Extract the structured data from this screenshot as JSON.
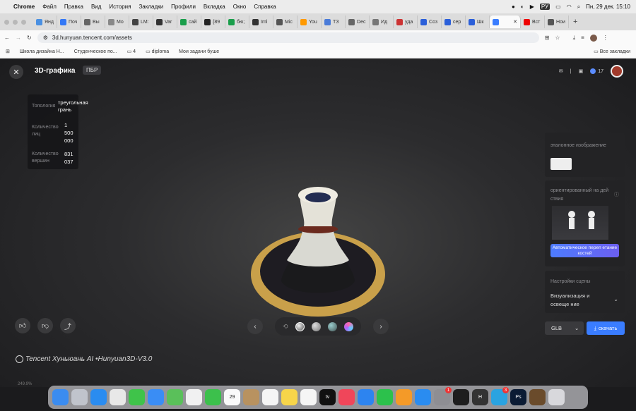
{
  "menubar": {
    "app": "Chrome",
    "items": [
      "Файл",
      "Правка",
      "Вид",
      "История",
      "Закладки",
      "Профили",
      "Вкладка",
      "Окно",
      "Справка"
    ],
    "lang": "РУ",
    "datetime": "Пн, 29 дек.  15:10"
  },
  "tabs": [
    {
      "label": "Янд",
      "color": "#4a90e2"
    },
    {
      "label": "Поч",
      "color": "#3478f6"
    },
    {
      "label": "Вы",
      "color": "#666"
    },
    {
      "label": "Мо",
      "color": "#888"
    },
    {
      "label": "LM:",
      "color": "#444"
    },
    {
      "label": "Var",
      "color": "#333"
    },
    {
      "label": "сай",
      "color": "#1a9e4b"
    },
    {
      "label": "{89",
      "color": "#222"
    },
    {
      "label": "бю;",
      "color": "#1a9e4b"
    },
    {
      "label": "Iml",
      "color": "#333"
    },
    {
      "label": "Mic",
      "color": "#555"
    },
    {
      "label": "You",
      "color": "#f90"
    },
    {
      "label": "ТЗ",
      "color": "#4a7bd8"
    },
    {
      "label": "Dec",
      "color": "#666"
    },
    {
      "label": "Ид",
      "color": "#777"
    },
    {
      "label": "уда",
      "color": "#c33"
    },
    {
      "label": "Соз",
      "color": "#2b5fd9"
    },
    {
      "label": "сер",
      "color": "#2b5fd9"
    },
    {
      "label": "Шк",
      "color": "#2b5fd9"
    },
    {
      "label": "",
      "color": "#3a7dff",
      "active": true
    },
    {
      "label": "Вст",
      "color": "#e00"
    },
    {
      "label": "Нои",
      "color": "#555"
    }
  ],
  "address": {
    "url": "3d.hunyuan.tencent.com/assets"
  },
  "bookmarks": {
    "items": [
      "Школа дизайна Н...",
      "Студенческое по...",
      "4",
      "diploma",
      "Мои задачи буше"
    ],
    "all": "Все закладки"
  },
  "app": {
    "title": "3D-графика",
    "badge": "ПБР",
    "credits": "17"
  },
  "stats": {
    "topology_label": "Топология",
    "topology_value": "треугольная грань",
    "faces_label": "Количество лиц",
    "faces_value": "1 500 000",
    "vertices_label": "Количество вершин",
    "vertices_value": "831 037"
  },
  "right_panel": {
    "reference_label": "эталонное изображение",
    "action_label": "ориентированный на дей ствия",
    "autorig_label": "Автоматическое переп етание костей",
    "scene_label": "Настройки сцены",
    "viz_label": "Визуализация и освеще ние",
    "format": "GLB",
    "download": "скачать"
  },
  "brand": "Tencent Хуньюань AI •Hunyuan3D-V3.0",
  "below_text": "249.9%",
  "dock": [
    {
      "name": "finder",
      "color": "#3b8cf0"
    },
    {
      "name": "launchpad",
      "color": "#c0c4cc"
    },
    {
      "name": "safari",
      "color": "#2a8cf0"
    },
    {
      "name": "chrome",
      "color": "#e8e8e8"
    },
    {
      "name": "messages",
      "color": "#3fc34a"
    },
    {
      "name": "mail",
      "color": "#3a8df5"
    },
    {
      "name": "maps",
      "color": "#5ac05a"
    },
    {
      "name": "photos",
      "color": "#f1f1f1"
    },
    {
      "name": "facetime",
      "color": "#3cc04c"
    },
    {
      "name": "calendar",
      "color": "#fafafa",
      "label": "29"
    },
    {
      "name": "contacts",
      "color": "#b89260"
    },
    {
      "name": "reminders",
      "color": "#f5f5f5"
    },
    {
      "name": "notes",
      "color": "#f7d54a"
    },
    {
      "name": "freeform",
      "color": "#f5f5f5"
    },
    {
      "name": "tv",
      "color": "#111",
      "label": "tv"
    },
    {
      "name": "music",
      "color": "#f0465a"
    },
    {
      "name": "keynote",
      "color": "#2d84f0"
    },
    {
      "name": "numbers",
      "color": "#2cc14c"
    },
    {
      "name": "pages",
      "color": "#f49a28"
    },
    {
      "name": "appstore",
      "color": "#2a8cf0"
    },
    {
      "name": "settings",
      "color": "#8e8e93",
      "badge": "1"
    },
    {
      "name": "figma",
      "color": "#1e1e1e"
    },
    {
      "name": "hunyuan",
      "color": "#333",
      "label": "H"
    },
    {
      "name": "telegram",
      "color": "#2aa3e0",
      "badge": "3"
    },
    {
      "name": "photoshop",
      "color": "#0b1b34",
      "label": "Ps"
    },
    {
      "name": "folder",
      "color": "#6a4b2b"
    },
    {
      "name": "trash",
      "color": "#d8d8dc"
    }
  ]
}
